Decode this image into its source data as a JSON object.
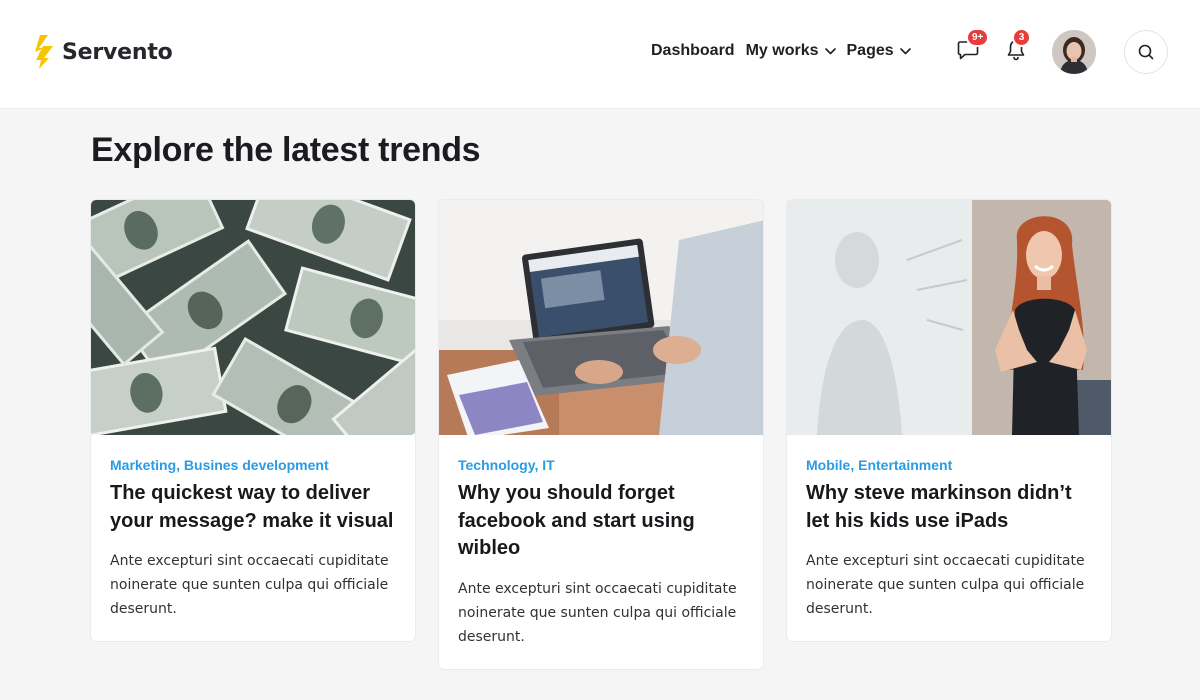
{
  "brand": {
    "name": "Servento",
    "accent": "#f6c400"
  },
  "nav": {
    "items": [
      {
        "label": "Dashboard",
        "dropdown": false
      },
      {
        "label": "My works",
        "dropdown": true
      },
      {
        "label": "Pages",
        "dropdown": true
      }
    ]
  },
  "header": {
    "messages_badge": "9+",
    "notifications_badge": "3",
    "icons": {
      "messages": "chat-bubble-icon",
      "notifications": "bell-icon",
      "search": "search-icon"
    }
  },
  "section": {
    "title": "Explore the latest trends"
  },
  "cards": [
    {
      "category": "Marketing, Busines development",
      "title": "The quickest way to deliver your message? make it visual",
      "excerpt": "Ante excepturi sint occaecati cupiditate noinerate que sunten culpa qui officiale deserunt."
    },
    {
      "category": "Technology, IT",
      "title": "Why you should forget facebook and start using wibleo",
      "excerpt": "Ante excepturi sint occaecati cupiditate noinerate que sunten culpa qui officiale deserunt."
    },
    {
      "category": "Mobile, Entertainment",
      "title": "Why steve markinson didn’t let his kids use iPads",
      "excerpt": "Ante excepturi sint occaecati cupiditate noinerate que sunten culpa qui officiale deserunt."
    }
  ],
  "colors": {
    "category": "#2b9be3",
    "badge": "#e83b3b",
    "background": "#f5f5f6"
  }
}
